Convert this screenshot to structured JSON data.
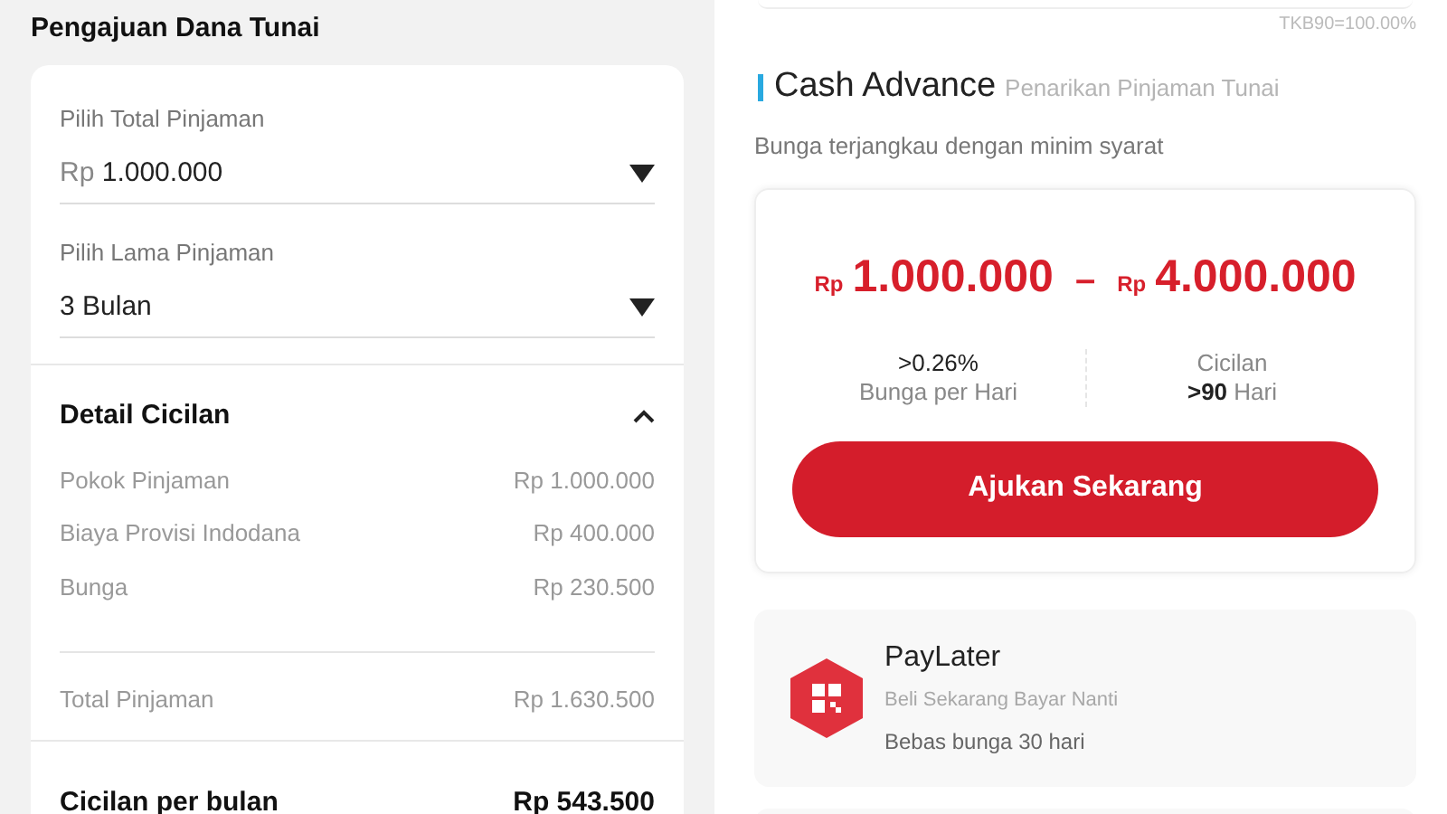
{
  "left": {
    "title": "Pengajuan Dana Tunai",
    "fields": [
      {
        "label": "Pilih Total Pinjaman",
        "prefix": "Rp",
        "value": "1.000.000"
      },
      {
        "label": "Pilih Lama Pinjaman",
        "value": "3 Bulan"
      }
    ],
    "detail": {
      "title": "Detail Cicilan",
      "expanded": true,
      "rows": [
        {
          "label": "Pokok Pinjaman",
          "value": "Rp 1.000.000"
        },
        {
          "label": "Biaya Provisi Indodana",
          "value": "Rp 400.000"
        },
        {
          "label": "Bunga",
          "value": "Rp 230.500"
        }
      ],
      "total": {
        "label": "Total Pinjaman",
        "value": "Rp 1.630.500"
      }
    },
    "monthly": {
      "label": "Cicilan per bulan",
      "value": "Rp 543.500"
    }
  },
  "right": {
    "tkb": "TKB90=100.00%",
    "cash_advance": {
      "title": "Cash Advance",
      "subtitle": "Penarikan Pinjaman Tunai",
      "tagline": "Bunga terjangkau dengan minim syarat",
      "range": {
        "min_currency": "Rp",
        "min": "1.000.000",
        "separator": "–",
        "max_currency": "Rp",
        "max": "4.000.000"
      },
      "stats": [
        {
          "value": ">0.26%",
          "label": "Bunga per Hari"
        },
        {
          "label": "Cicilan",
          "value": ">90",
          "unit": "Hari"
        }
      ],
      "button": "Ajukan Sekarang"
    },
    "paylater": {
      "title": "PayLater",
      "subtitle": "Beli Sekarang Bayar Nanti",
      "note": "Bebas bunga 30 hari"
    }
  }
}
